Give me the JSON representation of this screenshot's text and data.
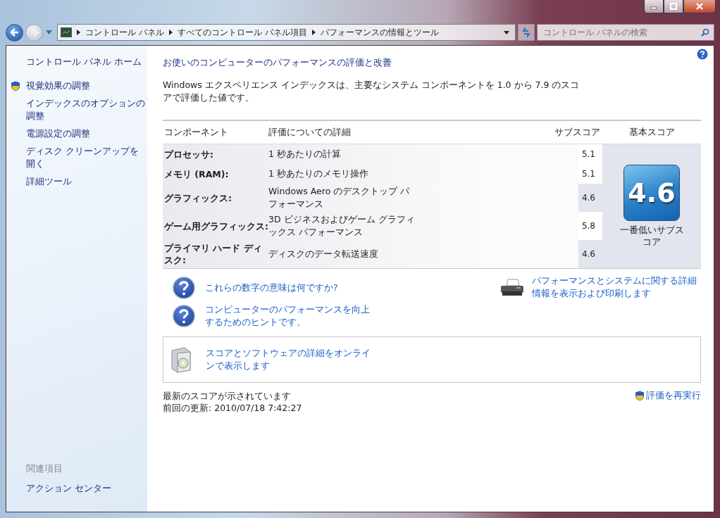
{
  "address_bar": {
    "breadcrumbs": [
      "コントロール パネル",
      "すべてのコントロール パネル項目",
      "パフォーマンスの情報とツール"
    ]
  },
  "search": {
    "placeholder": "コントロール パネルの検索"
  },
  "sidebar": {
    "home": "コントロール パネル ホーム",
    "tasks": [
      {
        "label": "視覚効果の調整",
        "kind": "shield"
      },
      {
        "label": "インデックスのオプションの調整",
        "kind": "plain"
      },
      {
        "label": "電源設定の調整",
        "kind": "plain"
      },
      {
        "label": "ディスク クリーンアップを開く",
        "kind": "plain"
      },
      {
        "label": "詳細ツール",
        "kind": "plain"
      }
    ],
    "related_heading": "関連項目",
    "related": [
      "アクション センター"
    ]
  },
  "main": {
    "title": "お使いのコンピューターのパフォーマンスの評価と改善",
    "description": "Windows エクスペリエンス インデックスは、主要なシステム コンポーネントを 1.0 から 7.9 のスコアで評価した値です。",
    "table": {
      "columns": [
        "コンポーネント",
        "評価についての詳細",
        "サブスコア",
        "基本スコア"
      ],
      "rows": [
        {
          "component": "プロセッサ:",
          "detail": "1 秒あたりの計算",
          "subscore": "5.1",
          "lowest": false
        },
        {
          "component": "メモリ (RAM):",
          "detail": "1 秒あたりのメモリ操作",
          "subscore": "5.1",
          "lowest": false
        },
        {
          "component": "グラフィックス:",
          "detail": "Windows Aero のデスクトップ パフォーマンス",
          "subscore": "4.6",
          "lowest": true
        },
        {
          "component": "ゲーム用グラフィックス:",
          "detail": "3D ビジネスおよびゲーム グラフィックス パフォーマンス",
          "subscore": "5.8",
          "lowest": false
        },
        {
          "component": "プライマリ ハード ディスク:",
          "detail": "ディスクのデータ転送速度",
          "subscore": "4.6",
          "lowest": true
        }
      ],
      "base_score": "4.6",
      "base_caption": "一番低いサブスコア"
    },
    "help_links": [
      "これらの数字の意味は何ですか?",
      "コンピューターのパフォーマンスを向上するためのヒントです。"
    ],
    "print_link": "パフォーマンスとシステムに関する詳細情報を表示および印刷します",
    "online_link": "スコアとソフトウェアの詳細をオンラインで表示します",
    "status": "最新のスコアが示されています",
    "last_updated": "前回の更新: 2010/07/18 7:42:27",
    "rerun": "評価を再実行"
  }
}
